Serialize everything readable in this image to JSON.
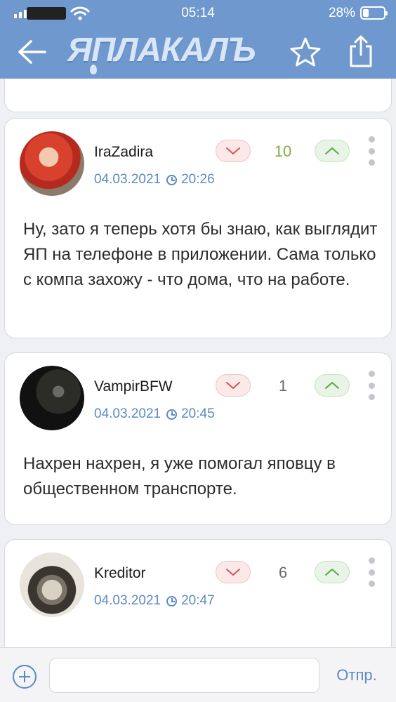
{
  "status": {
    "time": "05:14",
    "battery": "28%"
  },
  "nav": {
    "logo": "ЯПЛАКАЛЪ",
    "back_icon": "arrow-left-icon",
    "star_icon": "star-icon",
    "share_icon": "share-icon"
  },
  "comments": [
    {
      "author": "IraZadira",
      "date": "04.03.2021",
      "time": "20:26",
      "score": "10",
      "text": "Ну, зато я теперь хотя бы знаю, как выглядит ЯП на телефоне в приложении. Сама только с компа захожу - что дома, что на работе."
    },
    {
      "author": "VampirBFW",
      "date": "04.03.2021",
      "time": "20:45",
      "score": "1",
      "text": "Нахрен нахрен, я уже помогал яповцу в общественном транспорте."
    },
    {
      "author": "Kreditor",
      "date": "04.03.2021",
      "time": "20:47",
      "score": "6",
      "text": ""
    }
  ],
  "composer": {
    "placeholder": "",
    "send_label": "Отпр."
  },
  "colors": {
    "accent": "#6f98cf",
    "link": "#5a8ac4",
    "positive_score": "#7fb040"
  }
}
